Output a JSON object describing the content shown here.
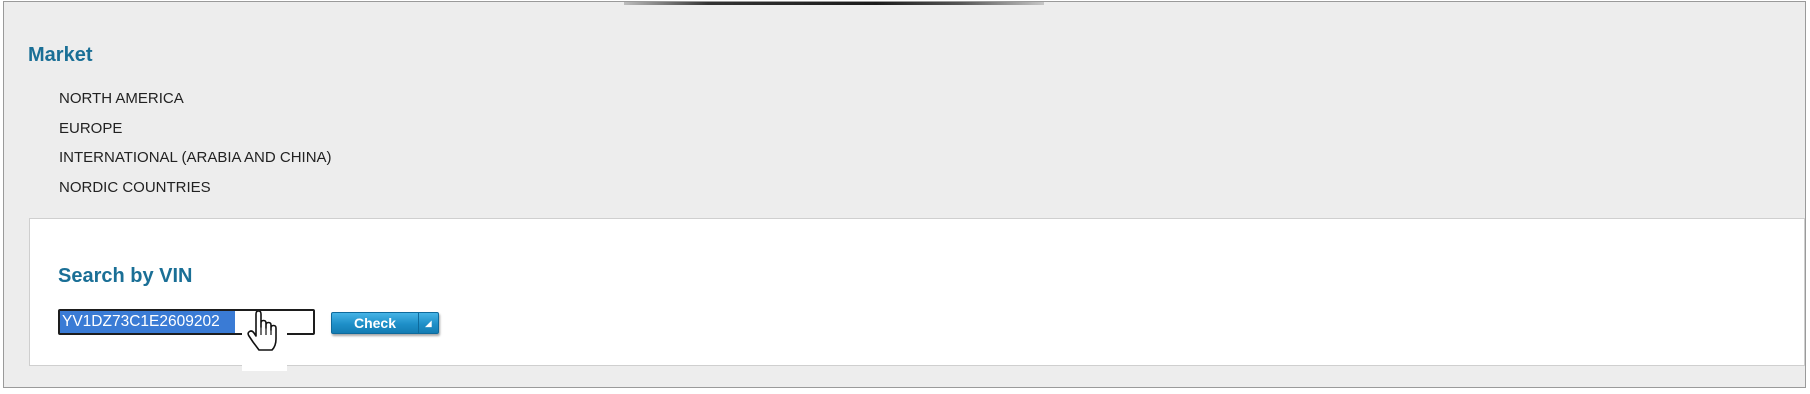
{
  "market": {
    "title": "Market",
    "regions": [
      {
        "label": "NORTH AMERICA"
      },
      {
        "label": "EUROPE"
      },
      {
        "label": "INTERNATIONAL (ARABIA AND CHINA)"
      },
      {
        "label": "NORDIC COUNTRIES"
      }
    ]
  },
  "vin_search": {
    "title": "Search by VIN",
    "input_value": "YV1DZ73C1E2609202",
    "check_label": "Check",
    "check_arrow_icon": "triangle-corner-icon"
  },
  "cursor": {
    "icon": "hand-pointer-icon"
  },
  "colors": {
    "accent": "#1a6f96",
    "button": "#1e8fc8",
    "selection": "#3a7bd5",
    "background": "#ededed"
  }
}
